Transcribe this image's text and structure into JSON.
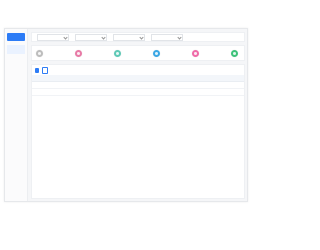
{
  "sidebar": {
    "brand": "",
    "items": [
      {
        "label": ""
      },
      {
        "label": ""
      },
      {
        "label": ""
      },
      {
        "label": ""
      },
      {
        "label": ""
      },
      {
        "label": ""
      },
      {
        "label": ""
      }
    ]
  },
  "filters": [
    {
      "label": "",
      "value": ""
    },
    {
      "label": "",
      "value": ""
    },
    {
      "label": "",
      "value": ""
    },
    {
      "label": "",
      "value": ""
    }
  ],
  "cards": [
    {
      "label": "",
      "value": "",
      "color": "#bdbdbd"
    },
    {
      "label": "",
      "value": "",
      "color": "#e87aa6"
    },
    {
      "label": "",
      "value": "",
      "color": "#5ec9b6"
    },
    {
      "label": "",
      "value": "",
      "color": "#3ba7e5"
    },
    {
      "label": "",
      "value": "",
      "color": "#f06aa8"
    },
    {
      "label": "",
      "value": "",
      "color": "#3dc27a"
    }
  ],
  "toolbar": {
    "primary_label": "",
    "secondary_label": ""
  },
  "table": {
    "columns": [
      "",
      "",
      "",
      "",
      "",
      "",
      "",
      ""
    ]
  },
  "colors": {
    "accent": "#2d7cf6"
  }
}
